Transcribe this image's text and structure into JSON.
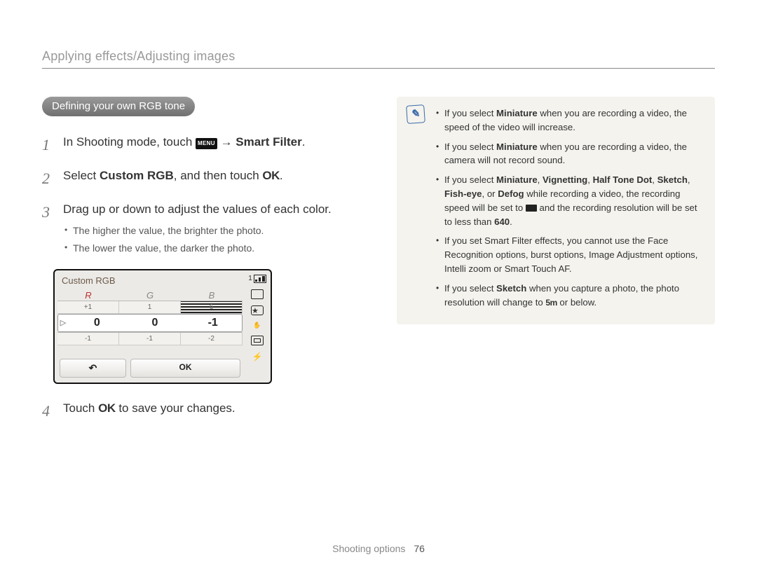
{
  "breadcrumb": "Applying effects/Adjusting images",
  "section_pill": "Defining your own RGB tone",
  "arrow": "→",
  "steps": {
    "s1_a": "In Shooting mode, touch ",
    "s1_menu": "MENU",
    "s1_b": " → ",
    "s1_bold": "Smart Filter",
    "s1_c": ".",
    "s2_a": "Select ",
    "s2_bold": "Custom RGB",
    "s2_b": ", and then touch ",
    "s2_ok": "OK",
    "s2_c": ".",
    "s3": "Drag up or down to adjust the values of each color.",
    "s3_sub1": "The higher the value, the brighter the photo.",
    "s3_sub2": "The lower the value, the darker the photo.",
    "s4_a": "Touch ",
    "s4_ok": "OK",
    "s4_b": " to save your changes."
  },
  "camera": {
    "title": "Custom RGB",
    "head_r": "R",
    "head_g": "G",
    "head_b": "B",
    "r_up": "+1",
    "g_up": "1",
    "b_up": "6",
    "r_main": "0",
    "g_main": "0",
    "b_main": "-1",
    "r_dn": "-1",
    "g_dn": "-1",
    "b_dn": "-2",
    "back": "↶",
    "ok_btn": "OK",
    "counter": "1"
  },
  "notes": {
    "n1_a": "If you select ",
    "n1_bold": "Miniature",
    "n1_b": " when you are recording a video, the speed of the video will increase.",
    "n2_a": "If you select ",
    "n2_bold": "Miniature",
    "n2_b": " when you are recording a video, the camera will not record sound.",
    "n3_a": "If you select ",
    "n3_list1": "Miniature",
    "n3_c1": ", ",
    "n3_list2": "Vignetting",
    "n3_c2": ", ",
    "n3_list3": "Half Tone Dot",
    "n3_c3": ", ",
    "n3_list4": "Sketch",
    "n3_c4": ", ",
    "n3_list5": "Fish-eye",
    "n3_c5": ", or ",
    "n3_list6": "Defog",
    "n3_b": " while recording a video, the recording speed will be set to ",
    "n3_c": " and the recording resolution will be set to less than ",
    "n3_640": "640",
    "n3_d": ".",
    "n4": "If you set Smart Filter effects, you cannot use the Face Recognition options, burst options, Image Adjustment options, Intelli zoom or Smart Touch AF.",
    "n5_a": "If you select ",
    "n5_bold": "Sketch",
    "n5_b": " when you capture a photo, the photo resolution will change to ",
    "n5_chip": "5m",
    "n5_c": " or below."
  },
  "footer_label": "Shooting options",
  "footer_page": "76"
}
